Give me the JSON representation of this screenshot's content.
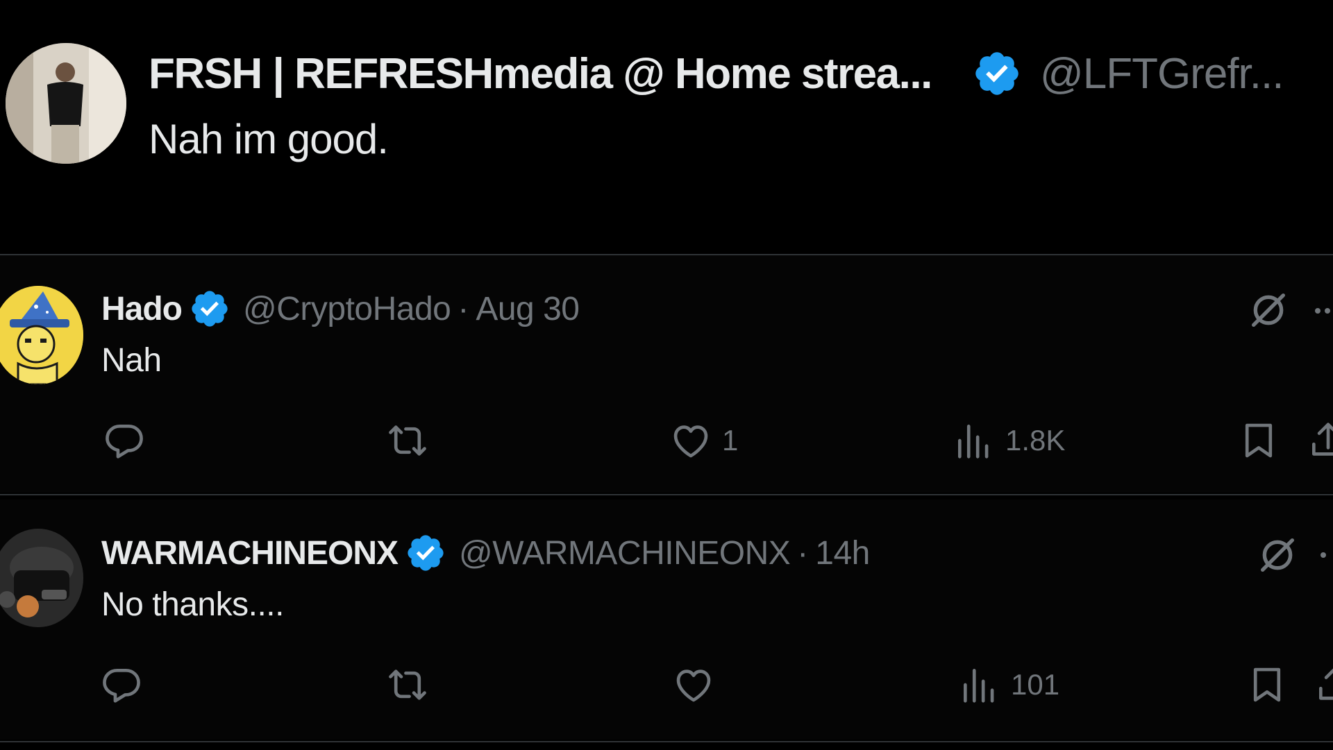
{
  "top_tweet": {
    "display_name": "FRSH | REFRESHmedia @ Home strea...",
    "handle": "@LFTGrefr...",
    "text": "Nah im good."
  },
  "replies": [
    {
      "display_name": "Hado",
      "handle": "@CryptoHado",
      "separator": "·",
      "time": "Aug 30",
      "text": "Nah",
      "actions": {
        "reply_count": "",
        "repost_count": "",
        "like_count": "1",
        "views_count": "1.8K"
      }
    },
    {
      "display_name": "WARMACHINEONX",
      "handle": "@WARMACHINEONX",
      "separator": "·",
      "time": "14h",
      "text": "No thanks....",
      "actions": {
        "reply_count": "",
        "repost_count": "",
        "like_count": "",
        "views_count": "101"
      }
    }
  ],
  "colors": {
    "background": "#000000",
    "text_primary": "#e7e9ea",
    "text_secondary": "#71767b",
    "verified_blue": "#1d9bf0",
    "divider": "#2f3336"
  },
  "icons": {
    "verified": "verified-badge-icon",
    "grok": "grok-icon",
    "more": "more-icon",
    "reply": "reply-icon",
    "repost": "repost-icon",
    "like": "heart-icon",
    "views": "views-icon",
    "bookmark": "bookmark-icon",
    "share": "share-icon"
  }
}
